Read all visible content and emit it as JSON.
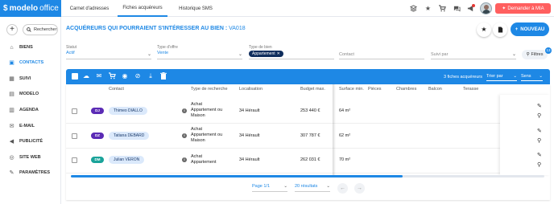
{
  "brand": {
    "name_bold": "modelo",
    "name_light": "office"
  },
  "top_tabs": [
    {
      "label": "Carnet d'adresses"
    },
    {
      "label": "Fiches acquéreurs"
    },
    {
      "label": "Historique SMS"
    }
  ],
  "top_icons": [
    "stack-icon",
    "star-icon",
    "cart-icon",
    "chat-icon",
    "megaphone-icon"
  ],
  "mia_button": {
    "label": "Demander à MIA"
  },
  "sidebar": {
    "search_label": "Rechercher",
    "items": [
      {
        "label": "BIENS",
        "icon": "home-icon"
      },
      {
        "label": "CONTACTS",
        "icon": "contact-icon"
      },
      {
        "label": "SUIVI",
        "icon": "calendar-icon"
      },
      {
        "label": "MODELO",
        "icon": "document-icon"
      },
      {
        "label": "AGENDA",
        "icon": "agenda-icon"
      },
      {
        "label": "E-MAIL",
        "icon": "mail-icon"
      },
      {
        "label": "PUBLICITÉ",
        "icon": "megaphone-icon"
      },
      {
        "label": "SITE WEB",
        "icon": "globe-icon"
      },
      {
        "label": "PARAMÈTRES",
        "icon": "wrench-icon"
      }
    ]
  },
  "header": {
    "title": "ACQUÉREURS QUI POURRAIENT S'INTÉRESSER AU BIEN :",
    "ref": "VA018",
    "new_button": "NOUVEAU"
  },
  "filters": {
    "statut_label": "Statut",
    "statut_value": "Actif",
    "offre_label": "Type d'offre",
    "offre_value": "Vente",
    "bien_label": "Type de bien",
    "bien_chip": "Appartement",
    "contact_placeholder": "Contact",
    "suivi_placeholder": "Suivi par",
    "filters_button": "Filtres",
    "filters_count": "13"
  },
  "toolbar": {
    "count_text": "3 fiches acquéreurs",
    "sort_label": "Trier par",
    "order_label": "Sens"
  },
  "columns": [
    "Contact",
    "Type de recherche",
    "Localisation",
    "Budget max.",
    "Surface min.",
    "Pièces",
    "Chambres",
    "Balcon",
    "Terasse"
  ],
  "rows": [
    {
      "initials": "DJ",
      "initials_color": "#5b2bb5",
      "name": "Thimeo DIALLO",
      "type_lines": [
        "Achat",
        "Appartement ou",
        "Maison"
      ],
      "location": "34 Hérault",
      "budget": "253 440 €",
      "surface": "64 m²"
    },
    {
      "initials": "DZ",
      "initials_color": "#5b2bb5",
      "name": "Tatiana DEBARD",
      "type_lines": [
        "Achat",
        "Appartement ou",
        "Maison"
      ],
      "location": "34 Hérault",
      "budget": "307 787 €",
      "surface": "62 m²"
    },
    {
      "initials": "DM",
      "initials_color": "#1aa39a",
      "name": "Julian VERON",
      "type_lines": [
        "Achat",
        "Appartement"
      ],
      "location": "34 Hérault",
      "budget": "262 031 €",
      "surface": "70 m²"
    }
  ],
  "pagination": {
    "page": "Page 1/1",
    "per_page": "20 résultats"
  }
}
